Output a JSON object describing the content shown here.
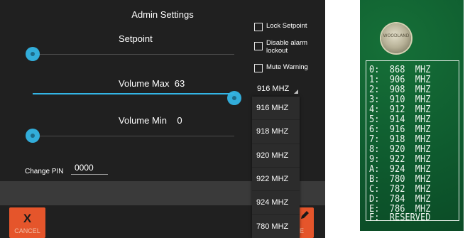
{
  "screen": {
    "title": "Admin Settings",
    "setpoint": {
      "label": "Setpoint",
      "level": 0.0
    },
    "volume_max": {
      "label": "Volume Max",
      "value": "63",
      "level": 1.0
    },
    "volume_min": {
      "label": "Volume Min",
      "value": "0",
      "level": 0.0
    },
    "checkboxes": {
      "lock_setpoint": {
        "label": "Lock Setpoint",
        "checked": false
      },
      "disable_alarm_lockout": {
        "label": "Disable alarm lockout",
        "checked": false
      },
      "mute_warning": {
        "label": "Mute Warning",
        "checked": false
      }
    },
    "frequency": {
      "selected": "916 MHZ",
      "options": [
        "916 MHZ",
        "918 MHZ",
        "920 MHZ",
        "922 MHZ",
        "924 MHZ",
        "780 MHZ"
      ]
    },
    "pin": {
      "label": "Change PIN",
      "value": "0000"
    },
    "buttons": {
      "cancel": {
        "icon": "X",
        "label": "CANCEL"
      },
      "save": {
        "icon": "pencil-icon",
        "label": "E"
      }
    },
    "accent_color": "#33b5e5",
    "button_color": "#e5552b"
  },
  "pcb": {
    "screw_text": "WOODLAND",
    "table": [
      "0:  868  MHZ",
      "1:  906  MHZ",
      "2:  908  MHZ",
      "3:  910  MHZ",
      "4:  912  MHZ",
      "5:  914  MHZ",
      "6:  916  MHZ",
      "7:  918  MHZ",
      "8:  920  MHZ",
      "9:  922  MHZ",
      "A:  924  MHZ",
      "B:  780  MHZ",
      "C:  782  MHZ",
      "D:  784  MHZ",
      "E:  786  MHZ",
      "F:  RESERVED"
    ]
  }
}
